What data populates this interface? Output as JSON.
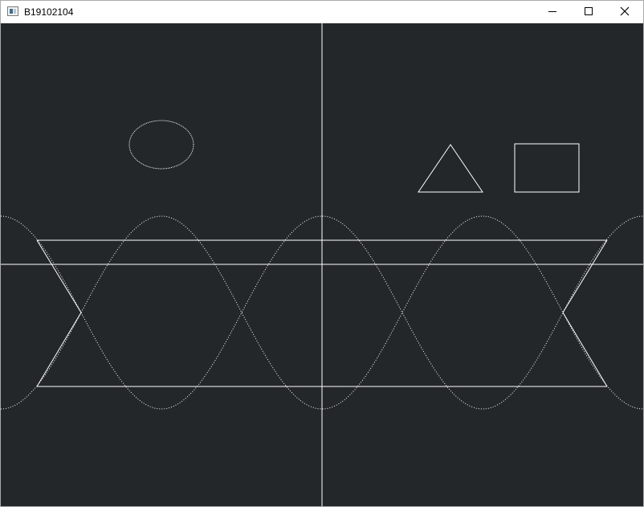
{
  "window": {
    "title": "B19102104",
    "app_icon": "application-window-icon",
    "controls": {
      "minimize": "minimize-icon",
      "maximize": "maximize-icon",
      "close": "close-icon"
    }
  },
  "canvas": {
    "background_color": "#23272a",
    "line_color": "#ffffff",
    "shapes": [
      "x-axis",
      "y-axis",
      "ellipse",
      "triangle",
      "rectangle",
      "sine-curve",
      "cosine-curve",
      "trapezoid-band"
    ]
  }
}
